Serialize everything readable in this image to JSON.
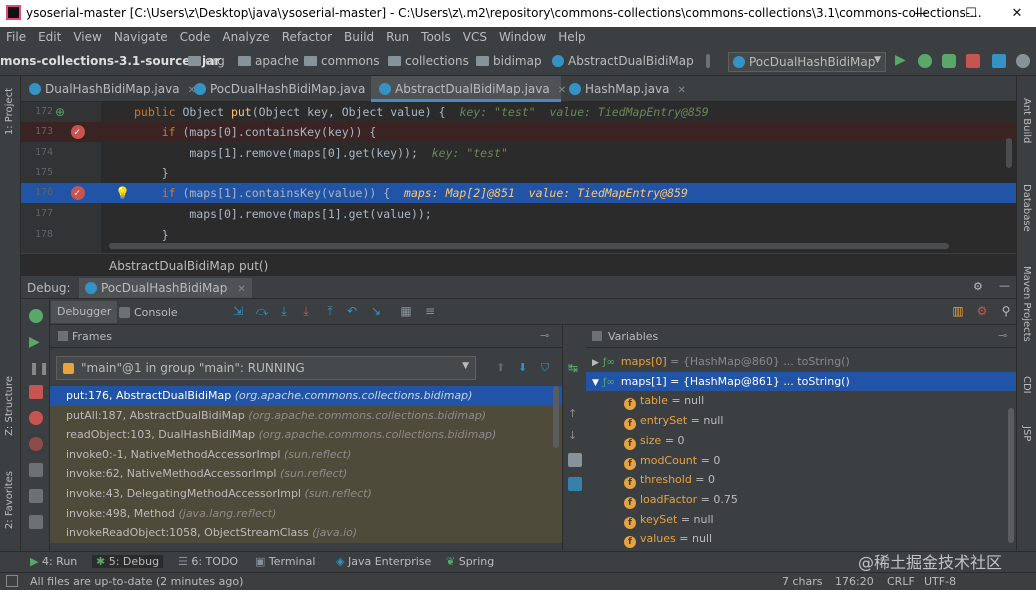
{
  "title_bar": {
    "text": "ysoserial-master [C:\\Users\\z\\Desktop\\java\\ysoserial-master] - C:\\Users\\z\\.m2\\repository\\commons-collections\\commons-collections\\3.1\\commons-collections-..."
  },
  "window_controls": {
    "minimize": "—",
    "maximize": "☐",
    "close": "✕"
  },
  "menu": [
    "File",
    "Edit",
    "View",
    "Navigate",
    "Code",
    "Analyze",
    "Refactor",
    "Build",
    "Run",
    "Tools",
    "VCS",
    "Window",
    "Help"
  ],
  "nav": {
    "jar": "mons-collections-3.1-sources.jar",
    "crumbs": [
      "org",
      "apache",
      "commons",
      "collections",
      "bidimap",
      "AbstractDualBidiMap"
    ],
    "run_config": "PocDualHashBidiMap"
  },
  "editor_tabs": [
    "DualHashBidiMap.java",
    "PocDualHashBidiMap.java",
    "AbstractDualBidiMap.java",
    "HashMap.java"
  ],
  "active_tab_index": 2,
  "code_lines": [
    {
      "num": "172",
      "parts": [
        [
          "kw",
          "public "
        ],
        [
          "",
          "Object "
        ],
        [
          "fn",
          "put"
        ],
        [
          "",
          "(Object key, Object value) {  "
        ],
        [
          "inl",
          "key: \"test\"  value: TiedMapEntry@859"
        ]
      ],
      "bp": false,
      "cur": false
    },
    {
      "num": "173",
      "parts": [
        [
          "kw",
          "    if "
        ],
        [
          "",
          "(maps[0].containsKey(key)) {"
        ]
      ],
      "bp": true,
      "cur": false
    },
    {
      "num": "174",
      "parts": [
        [
          "",
          "        maps[1].remove(maps[0].get(key));  "
        ],
        [
          "inl",
          "key: \"test\""
        ]
      ],
      "bp": false,
      "cur": false
    },
    {
      "num": "175",
      "parts": [
        [
          "",
          "    }"
        ]
      ],
      "bp": false,
      "cur": false
    },
    {
      "num": "176",
      "parts": [
        [
          "kw",
          "    if "
        ],
        [
          "",
          "(maps[1].containsKey(value)) {  "
        ],
        [
          "inlv",
          "maps: Map[2]@851  value: TiedMapEntry@859"
        ]
      ],
      "bp": true,
      "cur": true
    },
    {
      "num": "177",
      "parts": [
        [
          "",
          "        maps[0].remove(maps[1].get(value));"
        ]
      ],
      "bp": false,
      "cur": false
    },
    {
      "num": "178",
      "parts": [
        [
          "",
          "    }"
        ]
      ],
      "bp": false,
      "cur": false
    }
  ],
  "breadcrumb": [
    "AbstractDualBidiMap",
    "put()"
  ],
  "debug": {
    "label": "Debug:",
    "session": "PocDualHashBidiMap",
    "tabs": [
      "Debugger",
      "Console"
    ],
    "frames_header": "Frames",
    "variables_header": "Variables",
    "thread": "\"main\"@1 in group \"main\": RUNNING",
    "frames": [
      {
        "text": "put:176, AbstractDualBidiMap",
        "pkg": "(org.apache.commons.collections.bidimap)"
      },
      {
        "text": "putAll:187, AbstractDualBidiMap",
        "pkg": "(org.apache.commons.collections.bidimap)"
      },
      {
        "text": "readObject:103, DualHashBidiMap",
        "pkg": "(org.apache.commons.collections.bidimap)"
      },
      {
        "text": "invoke0:-1, NativeMethodAccessorImpl",
        "pkg": "(sun.reflect)"
      },
      {
        "text": "invoke:62, NativeMethodAccessorImpl",
        "pkg": "(sun.reflect)"
      },
      {
        "text": "invoke:43, DelegatingMethodAccessorImpl",
        "pkg": "(sun.reflect)"
      },
      {
        "text": "invoke:498, Method",
        "pkg": "(java.lang.reflect)"
      },
      {
        "text": "invokeReadObject:1058, ObjectStreamClass",
        "pkg": "(java.io)"
      }
    ],
    "variables": [
      {
        "name": "maps[0]",
        "value": " = {HashMap@860}  ... toString()",
        "level": 0,
        "arrow": "▶",
        "sel": false
      },
      {
        "name": "maps[1]",
        "value": " = {HashMap@861}  ... toString()",
        "level": 0,
        "arrow": "▼",
        "sel": true
      },
      {
        "name": "table",
        "value": " = null",
        "level": 1
      },
      {
        "name": "entrySet",
        "value": " = null",
        "level": 1
      },
      {
        "name": "size",
        "value": " = 0",
        "level": 1
      },
      {
        "name": "modCount",
        "value": " = 0",
        "level": 1
      },
      {
        "name": "threshold",
        "value": " = 0",
        "level": 1
      },
      {
        "name": "loadFactor",
        "value": " = 0.75",
        "level": 1
      },
      {
        "name": "keySet",
        "value": " = null",
        "level": 1
      },
      {
        "name": "values",
        "value": " = null",
        "level": 1
      }
    ]
  },
  "tool_tabs": [
    "4: Run",
    "5: Debug",
    "6: TODO",
    "Terminal",
    "Java Enterprise",
    "Spring"
  ],
  "status": {
    "message": "All files are up-to-date (2 minutes ago)",
    "chars": "7 chars",
    "pos": "176:20",
    "crlf": "CRLF",
    "enc": "UTF-8"
  },
  "left_strip": [
    "1: Project",
    "Z: Structure",
    "2: Favorites"
  ],
  "right_strip": [
    "Ant Build",
    "Database",
    "Maven Projects",
    "CDI",
    "JSP"
  ],
  "watermark": "@稀土掘金技术社区"
}
